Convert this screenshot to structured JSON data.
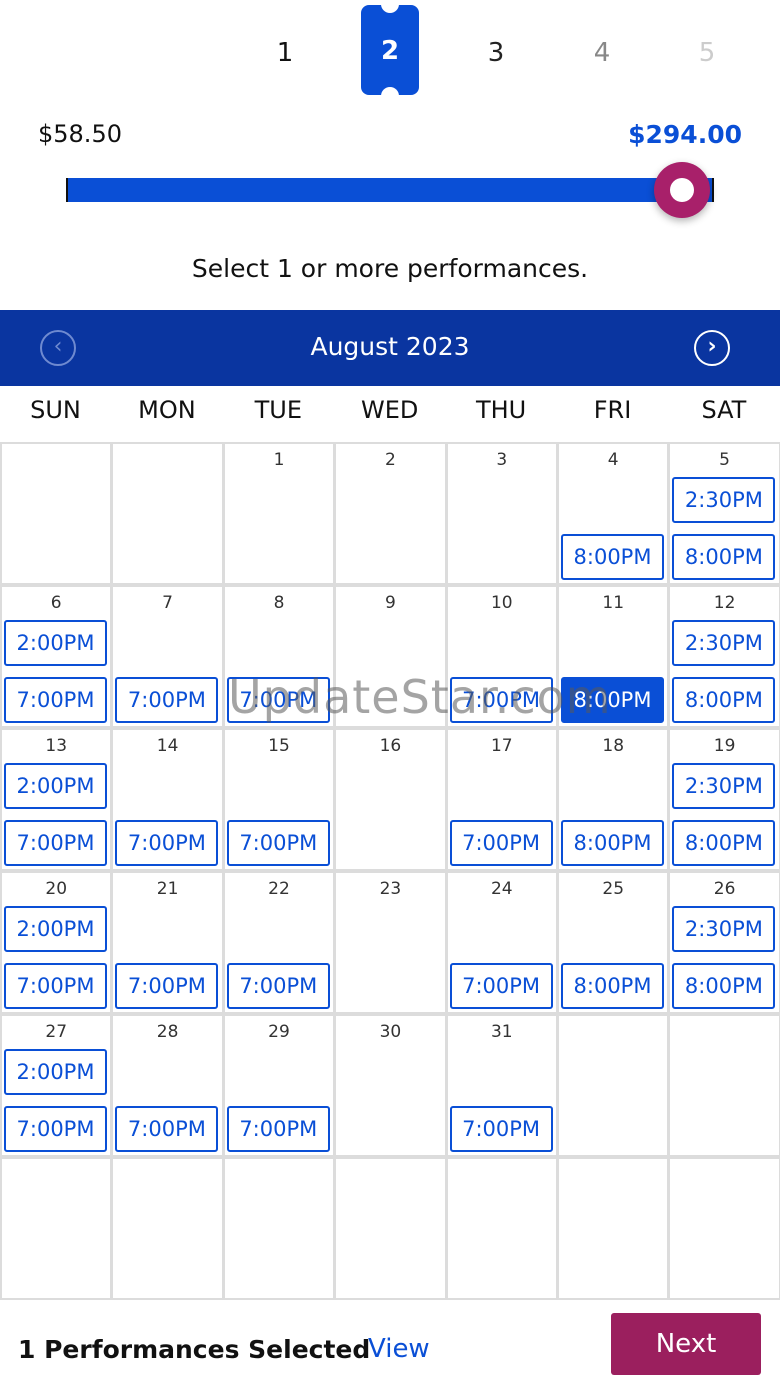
{
  "quantity": {
    "options": [
      "1",
      "2",
      "3",
      "4",
      "5"
    ],
    "selected": "2",
    "colors": {
      "selected": "#0a4fd6",
      "disabled": "#cccccc"
    }
  },
  "price": {
    "min_label": "$58.50",
    "max_label": "$294.00",
    "slider_value_fraction": 1.0,
    "colors": {
      "track": "#0a4fd6",
      "thumb": "#a8206a"
    }
  },
  "instruction": "Select 1 or more performances.",
  "calendar": {
    "month_label": "August 2023",
    "prev_icon": "chevron-left-icon",
    "next_icon": "chevron-right-icon",
    "weekdays": [
      "SUN",
      "MON",
      "TUE",
      "WED",
      "THU",
      "FRI",
      "SAT"
    ],
    "weeks": [
      [
        {
          "day": "",
          "times": []
        },
        {
          "day": "",
          "times": []
        },
        {
          "day": "1",
          "times": []
        },
        {
          "day": "2",
          "times": []
        },
        {
          "day": "3",
          "times": []
        },
        {
          "day": "4",
          "times": [
            "",
            "8:00PM"
          ]
        },
        {
          "day": "5",
          "times": [
            "2:30PM",
            "8:00PM"
          ]
        }
      ],
      [
        {
          "day": "6",
          "times": [
            "2:00PM",
            "7:00PM"
          ]
        },
        {
          "day": "7",
          "times": [
            "",
            "7:00PM"
          ]
        },
        {
          "day": "8",
          "times": [
            "",
            "7:00PM"
          ]
        },
        {
          "day": "9",
          "times": []
        },
        {
          "day": "10",
          "times": [
            "",
            "7:00PM"
          ]
        },
        {
          "day": "11",
          "times": [
            "",
            "8:00PM"
          ],
          "selected": "8:00PM"
        },
        {
          "day": "12",
          "times": [
            "2:30PM",
            "8:00PM"
          ]
        }
      ],
      [
        {
          "day": "13",
          "times": [
            "2:00PM",
            "7:00PM"
          ]
        },
        {
          "day": "14",
          "times": [
            "",
            "7:00PM"
          ]
        },
        {
          "day": "15",
          "times": [
            "",
            "7:00PM"
          ]
        },
        {
          "day": "16",
          "times": []
        },
        {
          "day": "17",
          "times": [
            "",
            "7:00PM"
          ]
        },
        {
          "day": "18",
          "times": [
            "",
            "8:00PM"
          ]
        },
        {
          "day": "19",
          "times": [
            "2:30PM",
            "8:00PM"
          ]
        }
      ],
      [
        {
          "day": "20",
          "times": [
            "2:00PM",
            "7:00PM"
          ]
        },
        {
          "day": "21",
          "times": [
            "",
            "7:00PM"
          ]
        },
        {
          "day": "22",
          "times": [
            "",
            "7:00PM"
          ]
        },
        {
          "day": "23",
          "times": []
        },
        {
          "day": "24",
          "times": [
            "",
            "7:00PM"
          ]
        },
        {
          "day": "25",
          "times": [
            "",
            "8:00PM"
          ]
        },
        {
          "day": "26",
          "times": [
            "2:30PM",
            "8:00PM"
          ]
        }
      ],
      [
        {
          "day": "27",
          "times": [
            "2:00PM",
            "7:00PM"
          ]
        },
        {
          "day": "28",
          "times": [
            "",
            "7:00PM"
          ]
        },
        {
          "day": "29",
          "times": [
            "",
            "7:00PM"
          ]
        },
        {
          "day": "30",
          "times": []
        },
        {
          "day": "31",
          "times": [
            "",
            "7:00PM"
          ]
        },
        {
          "day": "",
          "times": []
        },
        {
          "day": "",
          "times": []
        }
      ],
      [
        {
          "day": "",
          "times": []
        },
        {
          "day": "",
          "times": []
        },
        {
          "day": "",
          "times": []
        },
        {
          "day": "",
          "times": []
        },
        {
          "day": "",
          "times": []
        },
        {
          "day": "",
          "times": []
        },
        {
          "day": "",
          "times": []
        }
      ]
    ]
  },
  "watermark": "UpdateStar.com",
  "footer": {
    "selected_text": "1 Performances Selected",
    "view_label": "View",
    "next_label": "Next"
  }
}
